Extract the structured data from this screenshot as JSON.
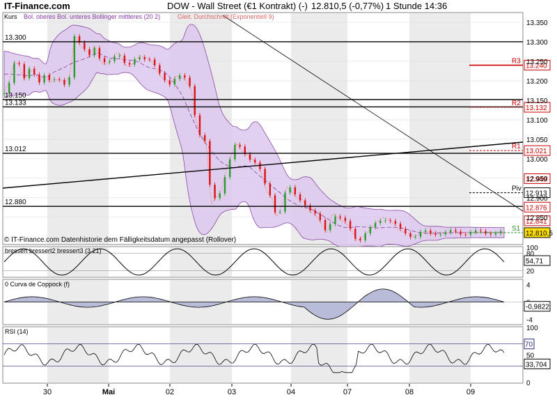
{
  "header": {
    "brand": "IT-Finance.com",
    "title": "DOW - Wall Street (€1 Kontrakt) (-)",
    "price": "12.810,5 (-0,77%)",
    "timeframe": "1 Stunde  14:36"
  },
  "colors": {
    "grid_shade": "#ebebeb",
    "bollinger_fill": "#dcc8ee",
    "bollinger_line": "#7a2a9a",
    "ema_line": "#e8806a",
    "candle_up": "#2a9a2a",
    "candle_down": "#dd1111",
    "pivot_label": "#cc0000",
    "rsi_line": "#2a2a7a"
  },
  "chart_data": [
    {
      "type": "candlestick",
      "panel": "price",
      "title": "Kurs",
      "legend": [
        "Bol. oberes Bol. unteres Bollinger mittleres (20 2)",
        "Gleit. Durchschnitt (Exponentiell 9)"
      ],
      "footnote": "© IT-Finance.com Datenhistorie dem Fälligkeitsdatum angepasst (Rollover)",
      "ylim": [
        12780,
        13375
      ],
      "y_ticks": [
        "13.350",
        "13.300",
        "13.250",
        "13.200",
        "13.150",
        "13.100",
        "13.050",
        "13.000",
        "12.950",
        "12.900",
        "12.850"
      ],
      "x_ticks": [
        "30",
        "Mai",
        "02",
        "03",
        "04",
        "07",
        "08",
        "09"
      ],
      "horizontal_lines": [
        {
          "label": "13.300",
          "value": 13300
        },
        {
          "label": "13.150",
          "value": 13152
        },
        {
          "label": "13.133",
          "value": 13133
        },
        {
          "label": "13.012",
          "value": 13014
        },
        {
          "label": "12.880",
          "value": 12878
        }
      ],
      "pivots": [
        {
          "name": "R3",
          "value": "13.240"
        },
        {
          "name": "R2",
          "value": "13.132"
        },
        {
          "name": "R1",
          "value": "13.021"
        },
        {
          "name": "Piv",
          "value": "12.913"
        },
        {
          "name": "S1",
          "value": "12.810,5"
        }
      ],
      "right_labels": [
        "12.949",
        "12.876",
        "12.841"
      ],
      "last_price": "12.810,5",
      "series": [
        {
          "name": "Kurs",
          "x": [
            0,
            3,
            6,
            9,
            12,
            15,
            18,
            21,
            24,
            27,
            30,
            33,
            36,
            39,
            42,
            45,
            48,
            51,
            54,
            57,
            60,
            63,
            66,
            69,
            72,
            75,
            78,
            81,
            84,
            87,
            90,
            93,
            96,
            99,
            102,
            105,
            108,
            111,
            114,
            117,
            120,
            123,
            126,
            129,
            132,
            135,
            138,
            141,
            144,
            147,
            150,
            153,
            156,
            159,
            162,
            165,
            168,
            171,
            174,
            177,
            180,
            183,
            186,
            189,
            192,
            195,
            198,
            201,
            204,
            207,
            210,
            213,
            216,
            219,
            222,
            225,
            228,
            231,
            234,
            237,
            240,
            243,
            246,
            249,
            252,
            255,
            258,
            261,
            264,
            267,
            270,
            273,
            276,
            279,
            282,
            285,
            288,
            291,
            294,
            297
          ],
          "close": [
            13168,
            13200,
            13250,
            13240,
            13200,
            13230,
            13220,
            13200,
            13215,
            13195,
            13200,
            13205,
            13195,
            13212,
            13320,
            13290,
            13280,
            13270,
            13290,
            13250,
            13240,
            13250,
            13270,
            13270,
            13240,
            13235,
            13255,
            13265,
            13260,
            13255,
            13230,
            13210,
            13200,
            13195,
            13212,
            13210,
            13200,
            13180,
            13095,
            13055,
            13040,
            12885,
            12900,
            12920,
            12975,
            13010,
            13040,
            13020,
            13010,
            13000,
            12990,
            12960,
            12915,
            12900,
            12850,
            12880,
            12930,
            12915,
            12900,
            12895,
            12880,
            12860,
            12850,
            12830,
            12810,
            12860,
            12850,
            12840,
            12830,
            12812,
            12790,
            12800,
            12812,
            12825,
            12840,
            12850,
            12845,
            12835,
            12820,
            12812,
            12810,
            12800,
            12805,
            12812,
            12808,
            12810,
            12812,
            12808,
            12810,
            12812,
            12811,
            12810,
            12812,
            12810,
            12811,
            12810,
            12812,
            12811,
            12810,
            12810
          ]
        }
      ]
    },
    {
      "type": "line",
      "panel": "bressert",
      "title": "bressert bressert2 bressert3 (3 21)",
      "ylim": [
        0,
        100
      ],
      "y_ticks": [
        "100",
        "80",
        "20"
      ],
      "last_value": "54,71"
    },
    {
      "type": "area",
      "panel": "coppock",
      "title": "0 Curva de Coppock (f)",
      "y_ticks": [
        "4",
        "0",
        "-4"
      ],
      "last_value": "-0,9822"
    },
    {
      "type": "line",
      "panel": "rsi",
      "title": "RSI (14)",
      "ylim": [
        0,
        100
      ],
      "y_ticks": [
        "100",
        "50",
        "0"
      ],
      "levels": [
        "70"
      ],
      "last_value": "33,704"
    }
  ]
}
